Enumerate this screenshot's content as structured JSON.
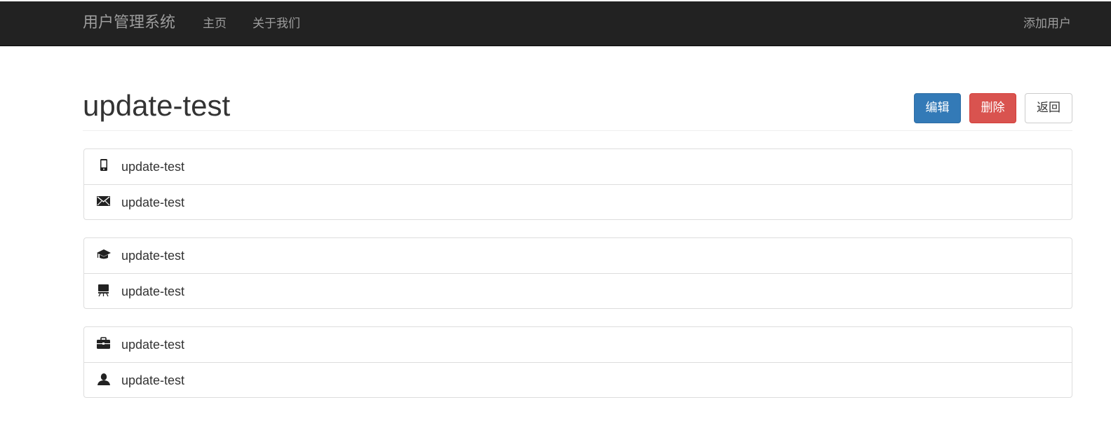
{
  "navbar": {
    "brand": "用户管理系统",
    "links": [
      {
        "label": "主页"
      },
      {
        "label": "关于我们"
      }
    ],
    "right_link": "添加用户"
  },
  "page": {
    "title": "update-test",
    "buttons": {
      "edit": "编辑",
      "delete": "删除",
      "back": "返回"
    }
  },
  "details": {
    "group1": [
      {
        "icon": "phone-icon",
        "value": "update-test"
      },
      {
        "icon": "envelope-icon",
        "value": "update-test"
      }
    ],
    "group2": [
      {
        "icon": "education-icon",
        "value": "update-test"
      },
      {
        "icon": "blackboard-icon",
        "value": "update-test"
      }
    ],
    "group3": [
      {
        "icon": "briefcase-icon",
        "value": "update-test"
      },
      {
        "icon": "user-icon",
        "value": "update-test"
      }
    ]
  },
  "colors": {
    "navbar_bg": "#222222",
    "nav_text": "#9d9d9d",
    "primary": "#337ab7",
    "danger": "#d9534f",
    "border": "#dddddd"
  }
}
